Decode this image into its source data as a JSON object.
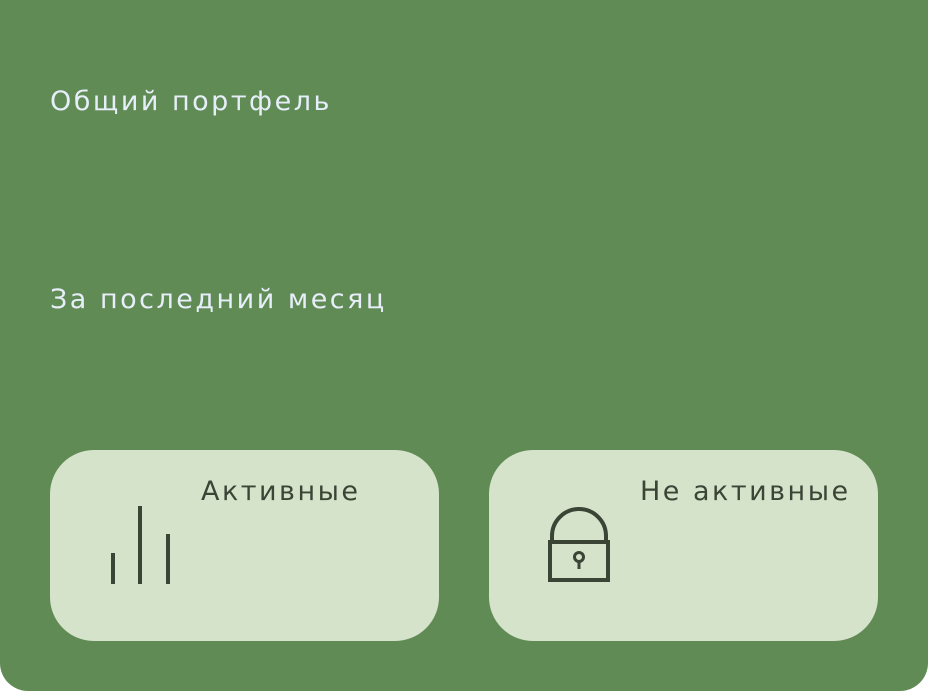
{
  "portfolio": {
    "total_label": "Общий портфель",
    "period_label": "За последний месяц"
  },
  "cards": {
    "active": {
      "label": "Активные",
      "icon": "bar-chart-icon"
    },
    "inactive": {
      "label": "Не активные",
      "icon": "lock-icon"
    }
  },
  "colors": {
    "panel_bg": "#618b55",
    "card_bg": "#d6e3cb",
    "label_text": "#e6eef9",
    "card_text": "#3a4536"
  }
}
